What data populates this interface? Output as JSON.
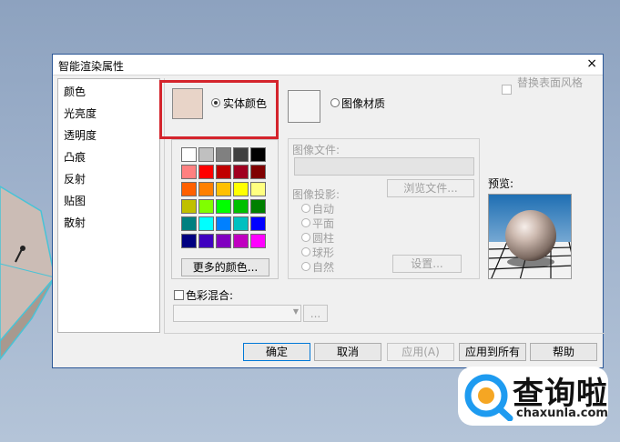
{
  "dialog": {
    "title": "智能渲染属性",
    "close_glyph": "×"
  },
  "sidebar": {
    "items": [
      {
        "label": "颜色"
      },
      {
        "label": "光亮度"
      },
      {
        "label": "透明度"
      },
      {
        "label": "凸痕"
      },
      {
        "label": "反射"
      },
      {
        "label": "贴图"
      },
      {
        "label": "散射"
      }
    ]
  },
  "material": {
    "solid_color_label": "实体颜色",
    "image_material_label": "图像材质",
    "replace_surface_style_label": "替换表面风格",
    "selected_color": "#e8d4c8"
  },
  "palette": {
    "colors": [
      [
        "#ffffff",
        "#c0c0c0",
        "#808080",
        "#404040",
        "#000000"
      ],
      [
        "#ff8080",
        "#ff0000",
        "#c00000",
        "#a00020",
        "#800000"
      ],
      [
        "#ff6000",
        "#ff8000",
        "#ffc000",
        "#ffff00",
        "#ffff80"
      ],
      [
        "#c0c000",
        "#80ff00",
        "#00ff00",
        "#00c000",
        "#008000"
      ],
      [
        "#008080",
        "#00ffff",
        "#0080ff",
        "#00c0c0",
        "#0000ff"
      ],
      [
        "#000080",
        "#4000c0",
        "#8000c0",
        "#c000c0",
        "#ff00ff"
      ]
    ],
    "more_colors_label": "更多的颜色..."
  },
  "image_panel": {
    "file_label": "图像文件:",
    "browse_label": "浏览文件...",
    "projection_label": "图像投影:",
    "projections": [
      {
        "label": "自动"
      },
      {
        "label": "平面"
      },
      {
        "label": "圆柱"
      },
      {
        "label": "球形"
      },
      {
        "label": "自然"
      }
    ],
    "settings_label": "设置..."
  },
  "preview_label": "预览:",
  "blend": {
    "label": "色彩混合:",
    "dots_label": "..."
  },
  "footer": {
    "ok": "确定",
    "cancel": "取消",
    "apply": "应用(A)",
    "apply_all": "应用到所有",
    "help": "帮助"
  },
  "watermark": {
    "brand": "查询啦",
    "url": "chaxunla.com"
  },
  "icons": [
    "close-icon",
    "radio-icon",
    "checkbox-icon",
    "chevron-down-icon",
    "search-logo-icon"
  ]
}
